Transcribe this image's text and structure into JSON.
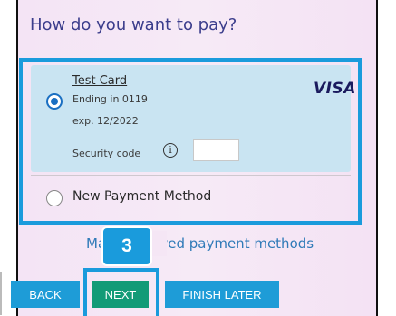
{
  "heading": "How do you want to pay?",
  "saved_card": {
    "name": "Test Card",
    "ending": "Ending in 0119",
    "expiry": "exp. 12/2022",
    "brand": "VISA",
    "security_label": "Security code",
    "security_value": "",
    "selected": true
  },
  "new_method": {
    "label": "New Payment Method",
    "selected": false
  },
  "manage_link": "Manage saved payment methods",
  "step_badge": "3",
  "buttons": {
    "back": "BACK",
    "next": "NEXT",
    "finish_later": "FINISH LATER"
  },
  "colors": {
    "accent_blue": "#1a9bdc",
    "next_green": "#129b77",
    "card_bg": "#c9e4f2",
    "heading": "#3b3d8c",
    "link": "#2f7ab8"
  },
  "icons": {
    "info": "info-circle-icon",
    "radio_selected": "radio-selected-icon",
    "radio_unselected": "radio-unselected-icon",
    "visa": "visa-logo"
  }
}
